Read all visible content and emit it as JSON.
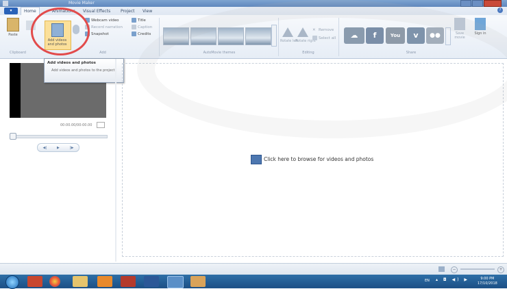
{
  "window": {
    "title": "Movie Maker"
  },
  "tabs": [
    {
      "label": "Home"
    },
    {
      "label": "Animations"
    },
    {
      "label": "Visual Effects"
    },
    {
      "label": "Project"
    },
    {
      "label": "View"
    }
  ],
  "ribbon": {
    "paste": "Paste",
    "add_videos": "Add videos and photos",
    "webcam": "Webcam video",
    "narration": "Record narration",
    "snapshot": "Snapshot",
    "title": "Title",
    "caption": "Caption",
    "credits": "Credits",
    "rotate_left": "Rotate left",
    "rotate_right": "Rotate right",
    "remove": "Remove",
    "select_all": "Select all",
    "save_movie": "Save movie",
    "sign_in": "Sign in",
    "groups": {
      "clipboard": "Clipboard",
      "add": "Add",
      "themes": "AutoMovie themes",
      "editing": "Editing",
      "share": "Share"
    }
  },
  "tooltip": {
    "title": "Add videos and photos",
    "description": "Add videos and photos to the project."
  },
  "preview": {
    "timecode": "00:00.00/00:00.00"
  },
  "storyboard": {
    "browse_text": "Click here to browse for videos and photos"
  },
  "taskbar": {
    "lang": "EN",
    "time": "9:00 PM",
    "date": "17/10/2018"
  },
  "colors": {
    "ribbon": "#e6edf6",
    "highlight_circle": "#e24b4b",
    "taskbar": "#1c4f85"
  }
}
